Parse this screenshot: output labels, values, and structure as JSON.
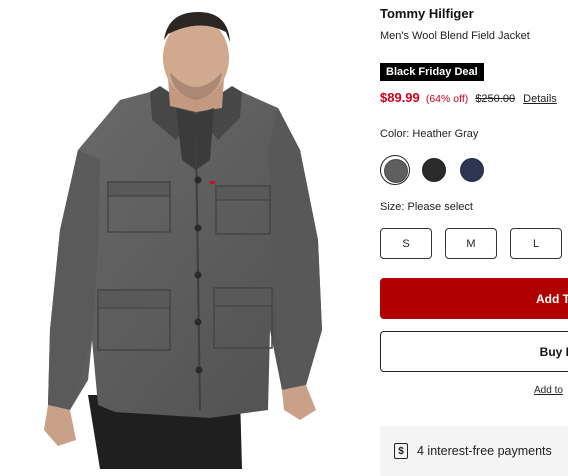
{
  "product": {
    "brand": "Tommy Hilfiger",
    "name": "Men's Wool Blend Field Jacket",
    "deal_badge": "Black Friday Deal",
    "price": {
      "sale": "$89.99",
      "discount": "(64% off)",
      "original": "$250.00",
      "details_link": "Details"
    }
  },
  "color": {
    "label": "Color: Heather Gray",
    "swatches": [
      {
        "name": "Heather Gray",
        "hex": "#5f5f5f",
        "selected": true
      },
      {
        "name": "Black",
        "hex": "#2a2a2a",
        "selected": false
      },
      {
        "name": "Navy",
        "hex": "#2d3754",
        "selected": false
      }
    ]
  },
  "size": {
    "label": "Size: Please select",
    "options": [
      "S",
      "M",
      "L"
    ]
  },
  "actions": {
    "add_to_bag": "Add T",
    "buy_now": "Buy I",
    "add_to_link": "Add to"
  },
  "payments": {
    "icon": "dollar-icon",
    "text": "4 interest-free payments"
  },
  "colors": {
    "sale_red": "#d0021b",
    "button_red": "#b00000",
    "badge_black": "#000000"
  }
}
